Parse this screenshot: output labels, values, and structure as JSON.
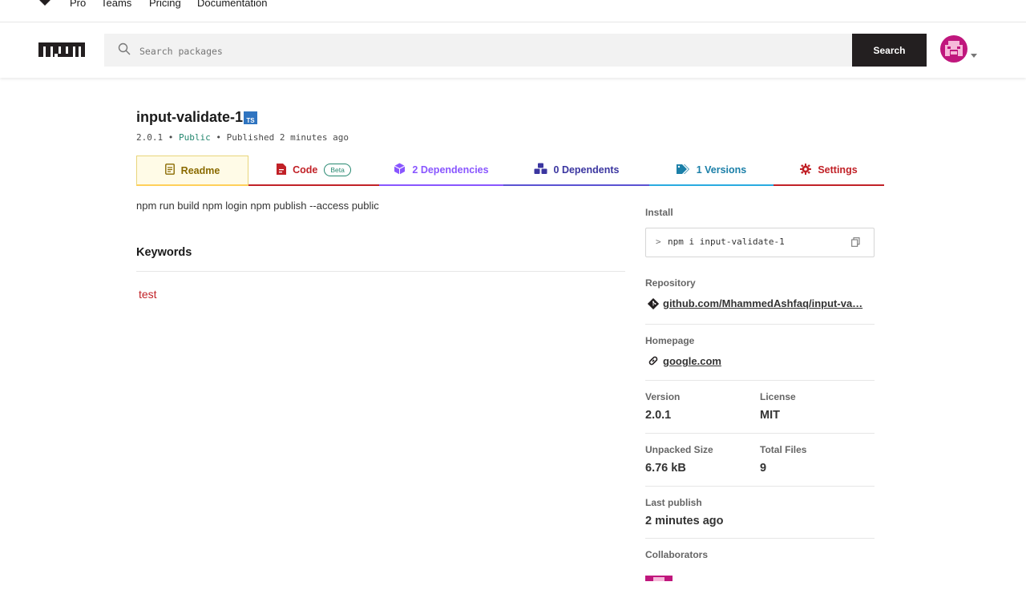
{
  "topnav": {
    "links": [
      "Pro",
      "Teams",
      "Pricing",
      "Documentation"
    ]
  },
  "header": {
    "logo": "npm",
    "search_placeholder": "Search packages",
    "search_button": "Search"
  },
  "package": {
    "name": "input-validate-1",
    "ts_badge": "TS",
    "version": "2.0.1",
    "visibility": "Public",
    "published": "Published 2 minutes ago"
  },
  "tabs": [
    {
      "label": "Readme"
    },
    {
      "label": "Code",
      "badge": "Beta"
    },
    {
      "label": "2 Dependencies"
    },
    {
      "label": "0 Dependents"
    },
    {
      "label": "1 Versions"
    },
    {
      "label": "Settings"
    }
  ],
  "readme": {
    "text": "npm run build npm login npm publish --access public",
    "keywords_title": "Keywords",
    "keywords": [
      "test"
    ]
  },
  "sidebar": {
    "install_label": "Install",
    "install_cmd": "npm i input-validate-1",
    "repository_label": "Repository",
    "repository_link": "github.com/MhammedAshfaq/input-va…",
    "homepage_label": "Homepage",
    "homepage_link": "google.com",
    "version_label": "Version",
    "version_value": "2.0.1",
    "license_label": "License",
    "license_value": "MIT",
    "unpacked_label": "Unpacked Size",
    "unpacked_value": "6.76 kB",
    "files_label": "Total Files",
    "files_value": "9",
    "last_publish_label": "Last publish",
    "last_publish_value": "2 minutes ago",
    "collaborators_label": "Collaborators"
  },
  "colors": {
    "npm_red": "#c12127",
    "ink": "#231f20",
    "avatar_magenta": "#c0177d"
  }
}
